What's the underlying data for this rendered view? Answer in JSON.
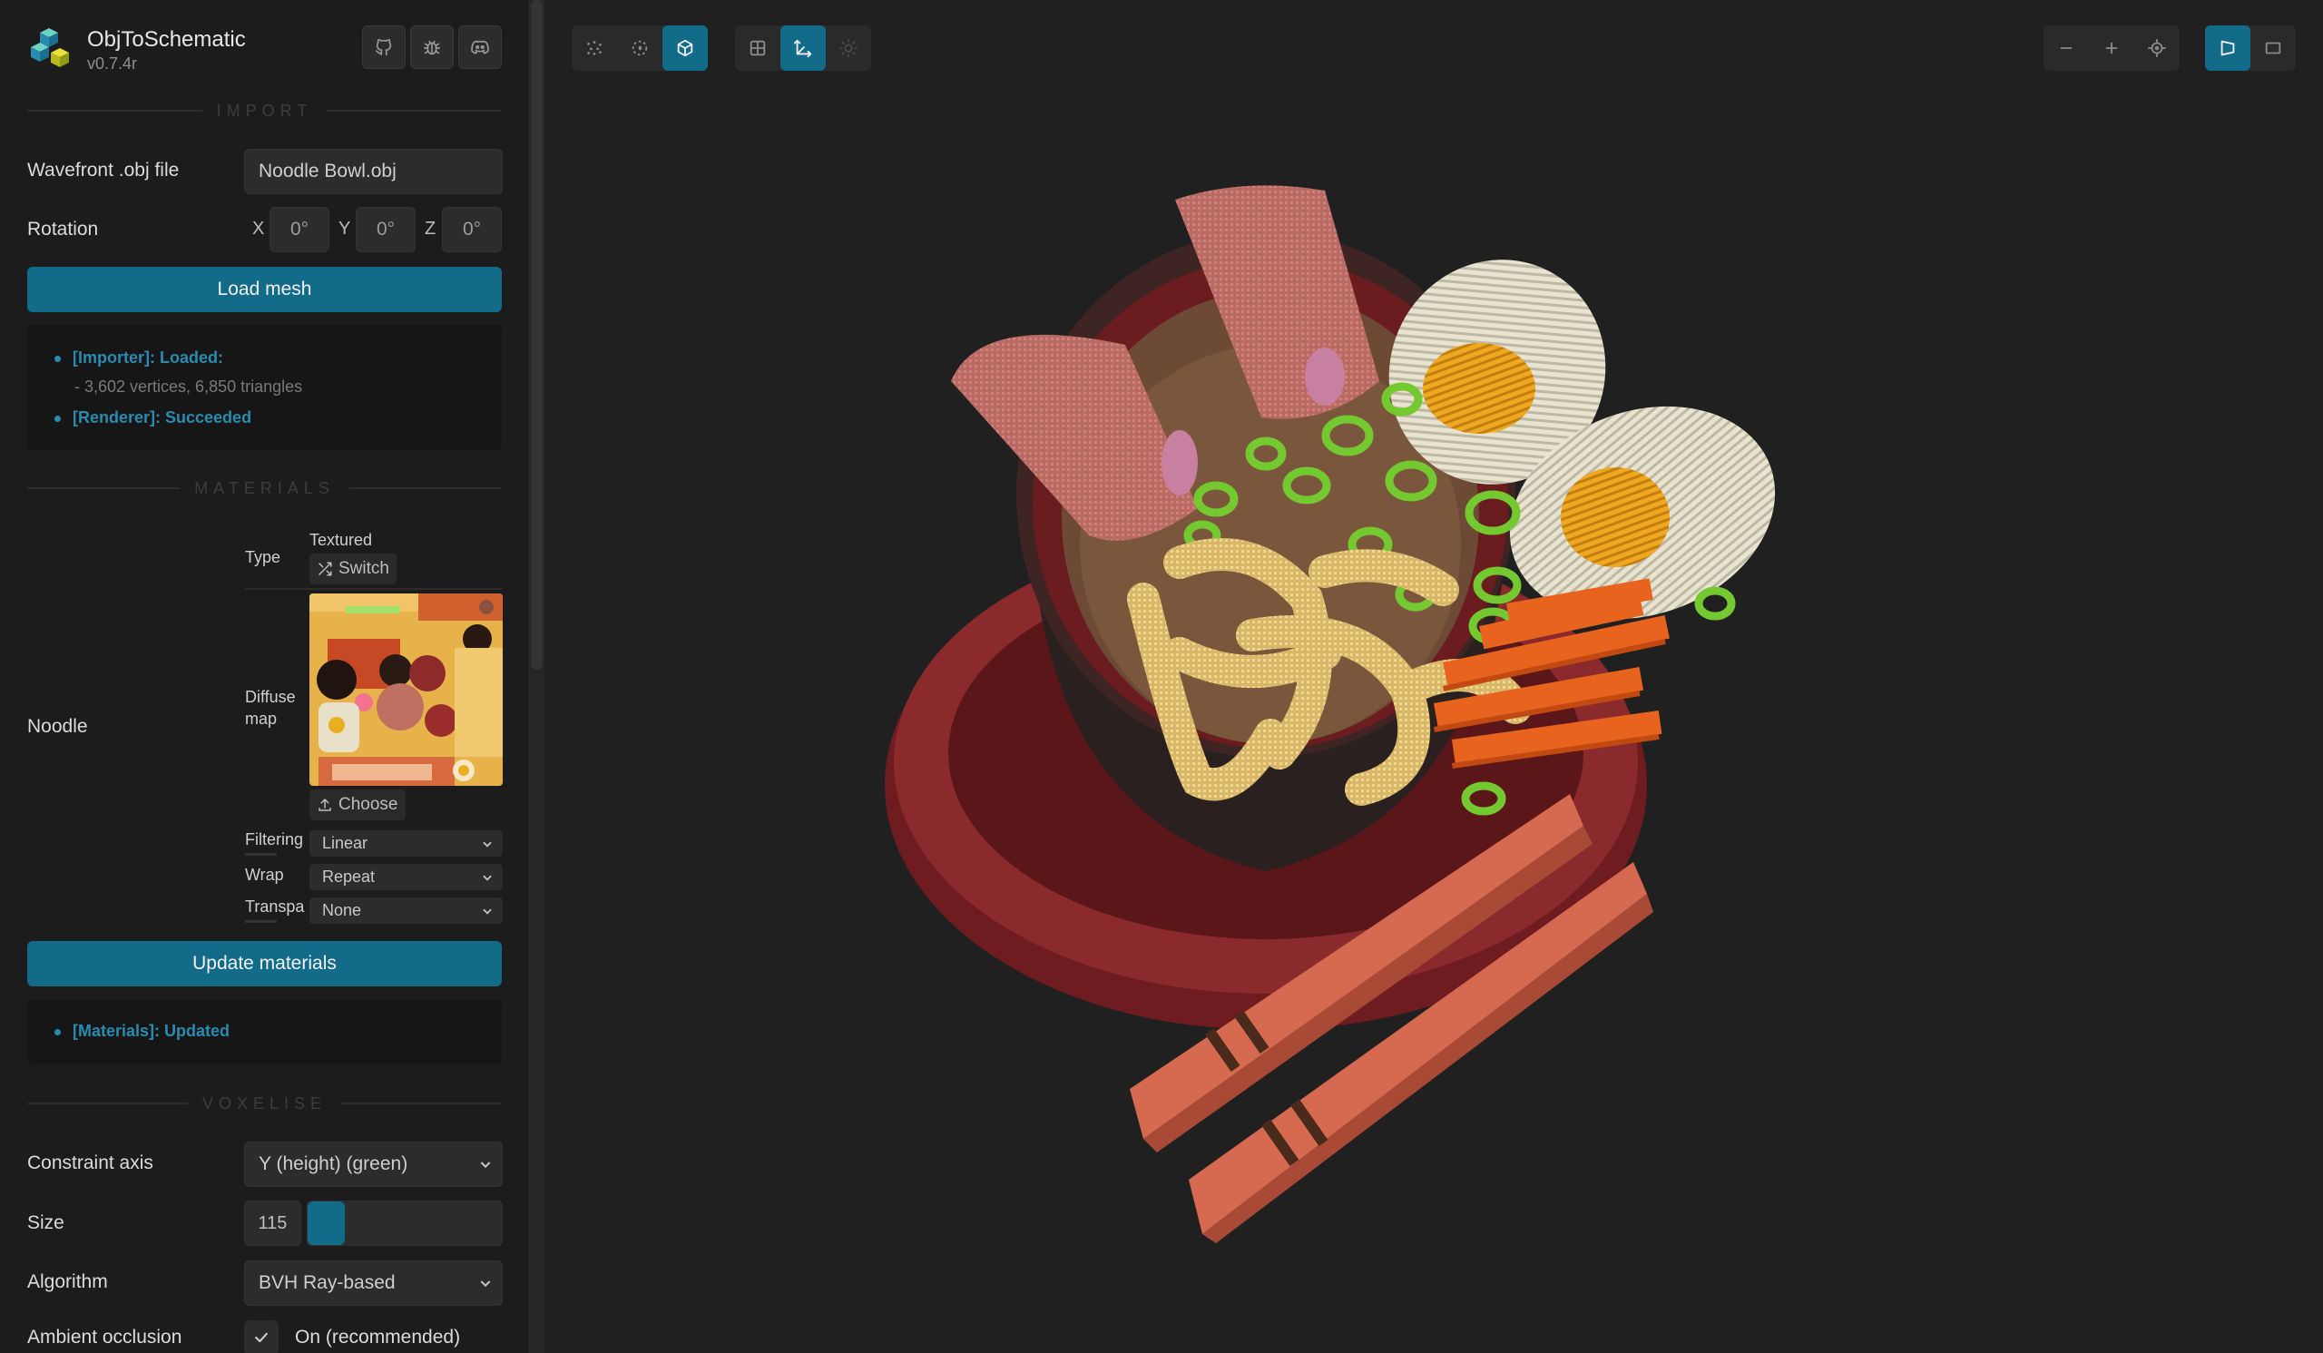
{
  "app": {
    "name": "ObjToSchematic",
    "version": "v0.7.4r"
  },
  "header_buttons": [
    "github-icon",
    "bug-icon",
    "discord-icon"
  ],
  "sections": {
    "import": "IMPORT",
    "materials": "MATERIALS",
    "voxelise": "VOXELISE"
  },
  "import": {
    "file_label": "Wavefront .obj file",
    "file_value": "Noodle Bowl.obj",
    "rotation_label": "Rotation",
    "rotation": [
      {
        "axis": "X",
        "value": "0°"
      },
      {
        "axis": "Y",
        "value": "0°"
      },
      {
        "axis": "Z",
        "value": "0°"
      }
    ],
    "load_button": "Load mesh",
    "log": {
      "line1": "[Importer]: Loaded:",
      "line1_detail": "- 3,602 vertices, 6,850 triangles",
      "line2": "[Renderer]: Succeeded"
    }
  },
  "materials": {
    "material_name": "Noodle",
    "type_label": "Type",
    "type_value": "Textured",
    "switch_button": "Switch",
    "diffuse_label_1": "Diffuse",
    "diffuse_label_2": "map",
    "choose_button": "Choose",
    "filtering_label": "Filtering",
    "filtering_value": "Linear",
    "wrap_label": "Wrap",
    "wrap_value": "Repeat",
    "transparency_label": "Transparency",
    "transparency_value": "None",
    "update_button": "Update materials",
    "log": {
      "line1": "[Materials]: Updated"
    }
  },
  "voxelise": {
    "constraint_label": "Constraint axis",
    "constraint_value": "Y (height) (green)",
    "size_label": "Size",
    "size_value": "115",
    "size_slider_fraction": 0.19,
    "algorithm_label": "Algorithm",
    "algorithm_value": "BVH Ray-based",
    "ao_label": "Ambient occlusion",
    "ao_value": "On (recommended)"
  },
  "colors": {
    "accent": "#136b8a",
    "log_text": "#2a8bb0",
    "background": "#202020",
    "panel": "#1c1c1c"
  }
}
